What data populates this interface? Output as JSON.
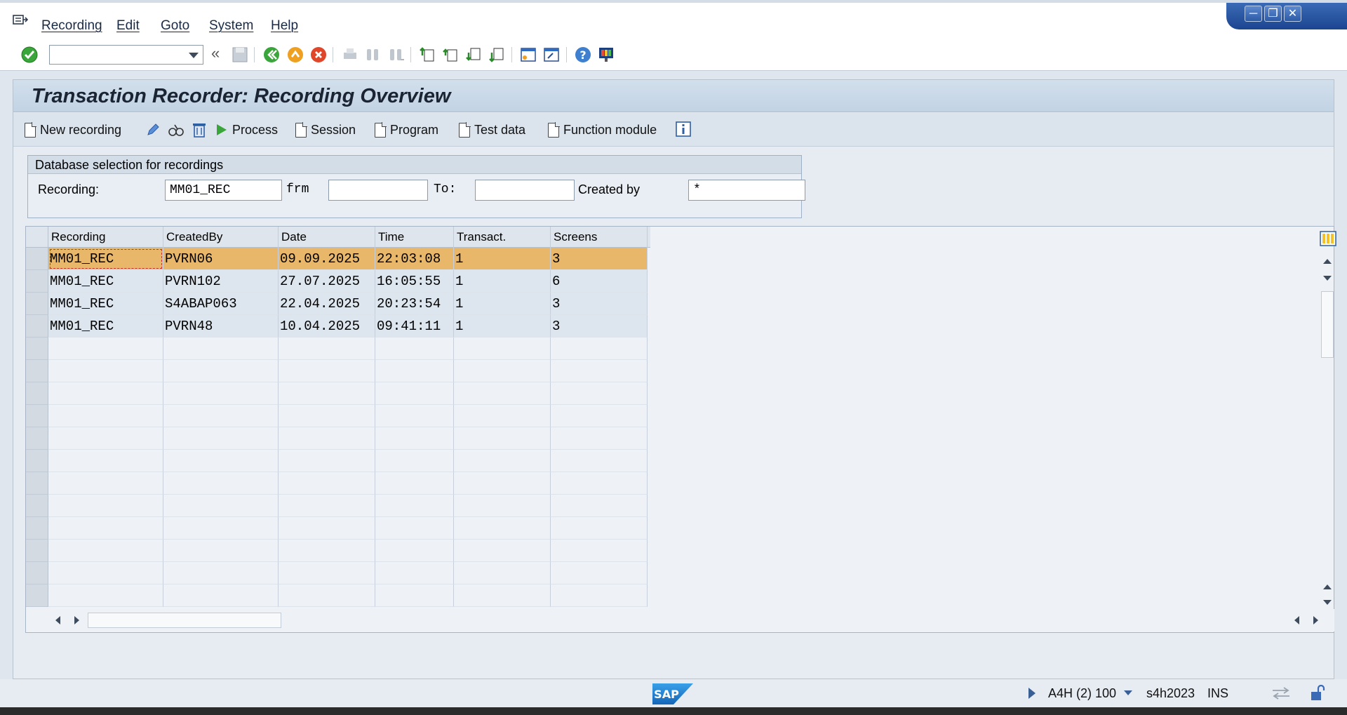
{
  "menu": {
    "items": [
      "Recording",
      "Edit",
      "Goto",
      "System",
      "Help"
    ]
  },
  "window_controls": [
    "minimize",
    "restore",
    "close"
  ],
  "toolbar": {
    "command_field_value": "",
    "icons": [
      "enter-icon",
      "back-double-icon",
      "save-icon",
      "back-icon",
      "exit-icon",
      "cancel-icon",
      "print-icon",
      "find-icon",
      "find-next-icon",
      "first-page-icon",
      "previous-page-icon",
      "next-page-icon",
      "last-page-icon",
      "create-session-icon",
      "shortcut-icon",
      "help-icon",
      "customize-layout-icon"
    ]
  },
  "page": {
    "title": "Transaction Recorder: Recording Overview"
  },
  "app_toolbar": {
    "new_recording": "New recording",
    "process": "Process",
    "session": "Session",
    "program": "Program",
    "test_data": "Test data",
    "function_module": "Function module"
  },
  "selection": {
    "header": "Database selection for recordings",
    "recording_label": "Recording:",
    "recording_value": "MM01_REC",
    "from_label": "frm",
    "from_value": "",
    "to_label": "To:",
    "to_value": "",
    "created_by_label": "Created by",
    "created_by_value": "*"
  },
  "table": {
    "columns": [
      "Recording",
      "CreatedBy",
      "Date",
      "Time",
      "Transact.",
      "Screens"
    ],
    "rows": [
      [
        "MM01_REC",
        "PVRN06",
        "09.09.2025",
        "22:03:08",
        "1",
        "3"
      ],
      [
        "MM01_REC",
        "PVRN102",
        "27.07.2025",
        "16:05:55",
        "1",
        "6"
      ],
      [
        "MM01_REC",
        "S4ABAP063",
        "22.04.2025",
        "20:23:54",
        "1",
        "3"
      ],
      [
        "MM01_REC",
        "PVRN48",
        "10.04.2025",
        "09:41:11",
        "1",
        "3"
      ]
    ],
    "selected_row": 0,
    "empty_rows": 12
  },
  "status": {
    "system": "A4H (2) 100",
    "server": "s4h2023",
    "mode": "INS"
  },
  "colors": {
    "selected_row": "#e9b76a",
    "title_bar": "#c7d7e8",
    "window_controls": "#2c5aa6"
  }
}
